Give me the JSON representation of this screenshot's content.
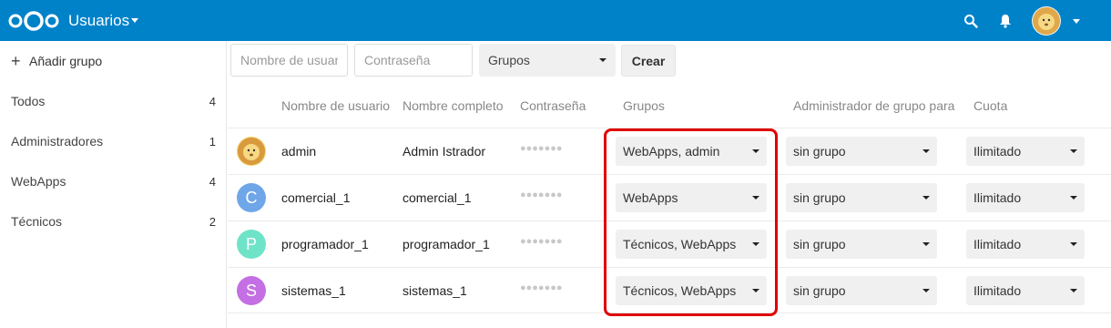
{
  "header": {
    "app_title": "Usuarios",
    "logo_icon": "nextcloud-logo",
    "search_icon": "search-icon",
    "bell_icon": "bell-icon",
    "bg_color": "#0082c9"
  },
  "sidebar": {
    "add_group_label": "Añadir grupo",
    "groups": [
      {
        "label": "Todos",
        "count": "4"
      },
      {
        "label": "Administradores",
        "count": "1"
      },
      {
        "label": "WebApps",
        "count": "4"
      },
      {
        "label": "Técnicos",
        "count": "2"
      }
    ]
  },
  "new_user": {
    "username_placeholder": "Nombre de usuario",
    "password_placeholder": "Contraseña",
    "groups_label": "Grupos",
    "create_label": "Crear"
  },
  "columns": {
    "username": "Nombre de usuario",
    "fullname": "Nombre completo",
    "password": "Contraseña",
    "groups": "Grupos",
    "subadmin": "Administrador de grupo para",
    "quota": "Cuota"
  },
  "users": [
    {
      "avatar_letter": "",
      "avatar_color": "#f2d06b",
      "username": "admin",
      "fullname": "Admin Istrador",
      "password": "●●●●●●●",
      "groups": "WebApps, admin",
      "subadmin": "sin grupo",
      "quota": "Ilimitado"
    },
    {
      "avatar_letter": "C",
      "avatar_color": "#6ea6e8",
      "username": "comercial_1",
      "fullname": "comercial_1",
      "password": "●●●●●●●",
      "groups": "WebApps",
      "subadmin": "sin grupo",
      "quota": "Ilimitado"
    },
    {
      "avatar_letter": "P",
      "avatar_color": "#6fe3c8",
      "username": "programador_1",
      "fullname": "programador_1",
      "password": "●●●●●●●",
      "groups": "Técnicos, WebApps",
      "subadmin": "sin grupo",
      "quota": "Ilimitado"
    },
    {
      "avatar_letter": "S",
      "avatar_color": "#c46fe3",
      "username": "sistemas_1",
      "fullname": "sistemas_1",
      "password": "●●●●●●●",
      "groups": "Técnicos, WebApps",
      "subadmin": "sin grupo",
      "quota": "Ilimitado"
    }
  ],
  "highlight_color": "#e00000"
}
